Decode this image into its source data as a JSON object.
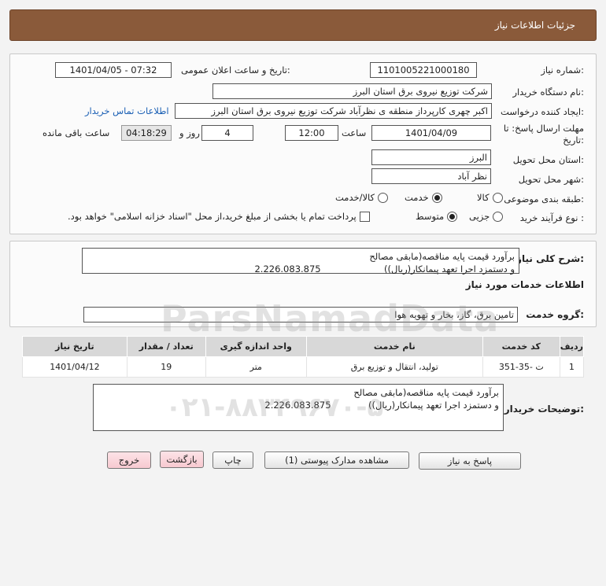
{
  "header": {
    "title": "جزئیات اطلاعات نیاز"
  },
  "form": {
    "need_number_label": "شماره نیاز:",
    "need_number": "1101005221000180",
    "announce_label": "تاریخ و ساعت اعلان عمومی:",
    "announce_value": "1401/04/05 - 07:32",
    "buyer_org_label": "نام دستگاه خریدار:",
    "buyer_org": "شرکت توزیع نیروی برق استان البرز",
    "creator_label": "ایجاد کننده درخواست:",
    "creator": "اکبر چهری کارپرداز منطقه ی نظرآباد شرکت توزیع نیروی برق استان البرز",
    "contact_link": "اطلاعات تماس خریدار",
    "deadline_label_1": "مهلت ارسال پاسخ: تا",
    "deadline_label_2": "تاریخ:",
    "deadline_date": "1401/04/09",
    "time_label": "ساعت",
    "deadline_time": "12:00",
    "days_value": "4",
    "days_label": "روز و",
    "remaining_time": "04:18:29",
    "remaining_label": "ساعت باقی مانده",
    "province_label": "استان محل تحویل:",
    "province": "البرز",
    "city_label": "شهر محل تحویل:",
    "city": "نظر آباد",
    "category_label": "طبقه بندی موضوعی:",
    "category_options": [
      "کالا",
      "خدمت",
      "کالا/خدمت"
    ],
    "category_selected": "خدمت",
    "process_label": "نوع فرآیند خرید :",
    "process_options": [
      "جزیی",
      "متوسط"
    ],
    "process_selected": "متوسط",
    "payment_note": "پرداخت تمام یا بخشی از مبلغ خرید،از محل \"اسناد خزانه اسلامی\" خواهد بود."
  },
  "summary": {
    "label": "شرح کلی نیاز:",
    "line1": "برآورد قیمت پایه مناقصه(مابقی مصالح",
    "line2": "و دستمزد اجرا تعهد پیمانکار(ریال))                      2.226.083.875"
  },
  "services": {
    "title": "اطلاعات خدمات مورد نیاز",
    "group_label": "گروه خدمت:",
    "group_value": "تامین برق، گاز، بخار و تهویه هوا"
  },
  "table": {
    "headers": [
      "ردیف",
      "کد خدمت",
      "نام خدمت",
      "واحد اندازه گیری",
      "تعداد / مقدار",
      "تاریخ نیاز"
    ],
    "rows": [
      [
        "1",
        "ت -35-351",
        "تولید، انتقال و توزیع برق",
        "متر",
        "19",
        "1401/04/12"
      ]
    ]
  },
  "buyer_notes": {
    "label": "توضیحات خریدار:",
    "line1": "برآورد قیمت پایه مناقصه(مابقی مصالح",
    "line2": "و دستمزد اجرا تعهد پیمانکار(ریال))             2.226.083.875"
  },
  "buttons": {
    "reply": "پاسخ به نیاز",
    "attachments": "مشاهده مدارک پیوستی (1)",
    "print": "چاپ",
    "back": "بازگشت",
    "exit": "خروج"
  },
  "watermark": {
    "brand": "ParsNamadData",
    "phone": "۰۲۱-۸۸۳۴۹۶۷۰-۵"
  }
}
